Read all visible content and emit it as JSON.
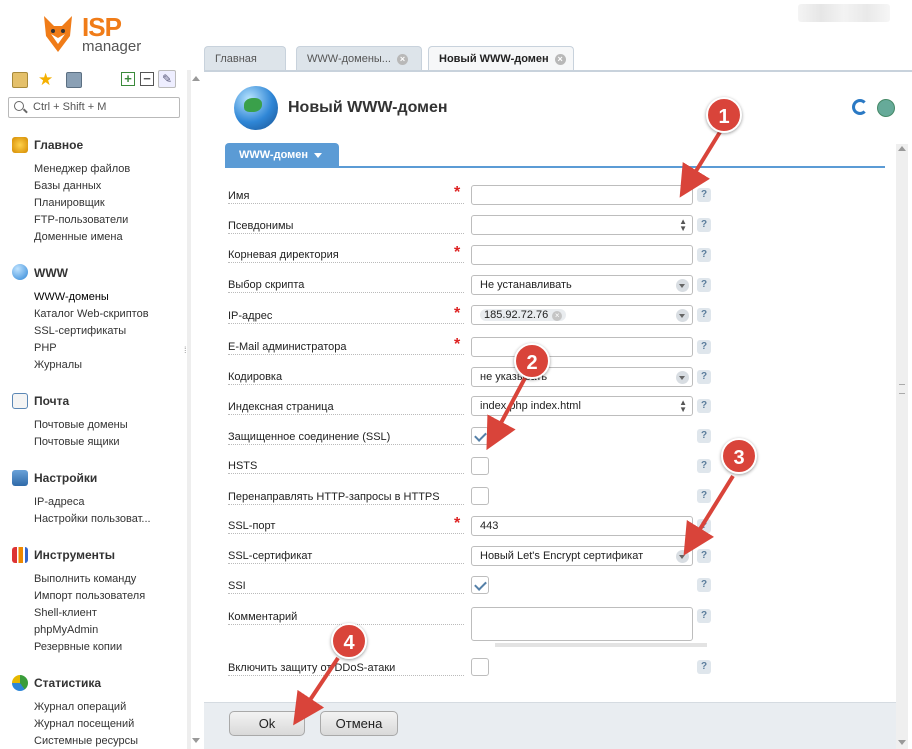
{
  "brand": {
    "isp": "ISP",
    "manager": "manager"
  },
  "search": {
    "placeholder": "Ctrl + Shift + M"
  },
  "tabs": [
    {
      "label": "Главная"
    },
    {
      "label": "WWW-домены..."
    },
    {
      "label": "Новый WWW-домен"
    }
  ],
  "sidebar": {
    "sections": [
      {
        "title": "Главное",
        "items": [
          "Менеджер файлов",
          "Базы данных",
          "Планировщик",
          "FTP-пользователи",
          "Доменные имена"
        ]
      },
      {
        "title": "WWW",
        "items": [
          "WWW-домены",
          "Каталог Web-скриптов",
          "SSL-сертификаты",
          "PHP",
          "Журналы"
        ]
      },
      {
        "title": "Почта",
        "items": [
          "Почтовые домены",
          "Почтовые ящики"
        ]
      },
      {
        "title": "Настройки",
        "items": [
          "IP-адреса",
          "Настройки пользоват..."
        ]
      },
      {
        "title": "Инструменты",
        "items": [
          "Выполнить команду",
          "Импорт пользователя",
          "Shell-клиент",
          "phpMyAdmin",
          "Резервные копии"
        ]
      },
      {
        "title": "Статистика",
        "items": [
          "Журнал операций",
          "Журнал посещений",
          "Системные ресурсы"
        ]
      }
    ]
  },
  "page": {
    "title": "Новый WWW-домен",
    "subtab": "WWW-домен"
  },
  "form": {
    "name_label": "Имя",
    "aliases_label": "Псевдонимы",
    "root_label": "Корневая директория",
    "script_label": "Выбор скрипта",
    "script_value": "Не устанавливать",
    "ip_label": "IP-адрес",
    "ip_value": "185.92.72.76",
    "email_label": "E-Mail администратора",
    "charset_label": "Кодировка",
    "charset_value": "не указывать",
    "index_label": "Индексная страница",
    "index_value": "index.php index.html",
    "ssl_label": "Защищенное соединение (SSL)",
    "hsts_label": "HSTS",
    "redirect_label": "Перенаправлять HTTP-запросы в HTTPS",
    "ssl_port_label": "SSL-порт",
    "ssl_port_value": "443",
    "ssl_cert_label": "SSL-сертификат",
    "ssl_cert_value": "Новый Let's Encrypt сертификат",
    "ssi_label": "SSI",
    "comment_label": "Комментарий",
    "ddos_label": "Включить защиту от DDoS-атаки",
    "help_glyph": "?"
  },
  "buttons": {
    "ok": "Ok",
    "cancel": "Отмена"
  },
  "annotations": [
    "1",
    "2",
    "3",
    "4"
  ],
  "colors": {
    "accent": "#5b9bd5",
    "badge": "#d9443a",
    "brand_orange": "#f07c18"
  },
  "checkbox_states": {
    "ssl": true,
    "hsts": false,
    "redirect": false,
    "ssi": true,
    "ddos": false
  }
}
